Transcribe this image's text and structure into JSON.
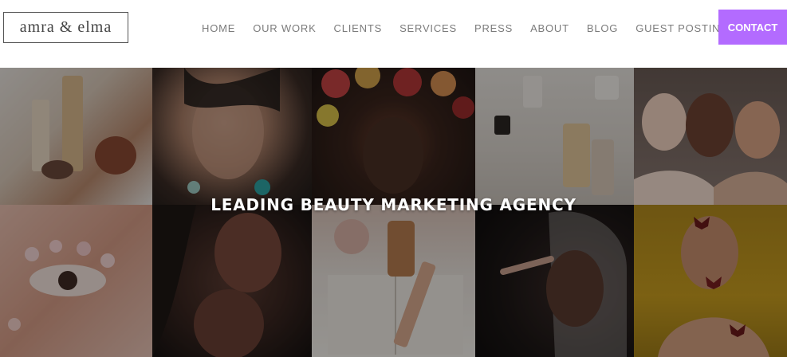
{
  "header": {
    "logo_text": "amra & elma",
    "nav": [
      "HOME",
      "OUR WORK",
      "CLIENTS",
      "SERVICES",
      "PRESS",
      "ABOUT",
      "BLOG",
      "GUEST POSTING"
    ],
    "contact_label": "CONTACT",
    "accent_color": "#b36bff"
  },
  "hero": {
    "title": "LEADING BEAUTY MARKETING AGENCY",
    "tiles": [
      {
        "subject": "skincare-products-photo"
      },
      {
        "subject": "man-with-earrings-portrait"
      },
      {
        "subject": "woman-with-flower-crown-portrait"
      },
      {
        "subject": "perfume-bottles-photo"
      },
      {
        "subject": "three-women-group-portrait"
      },
      {
        "subject": "floral-eye-makeup-closeup"
      },
      {
        "subject": "two-women-portrait"
      },
      {
        "subject": "book-and-cosmetics-photo"
      },
      {
        "subject": "woman-applying-makeup-photo"
      },
      {
        "subject": "man-with-butterflies-portrait"
      }
    ]
  }
}
